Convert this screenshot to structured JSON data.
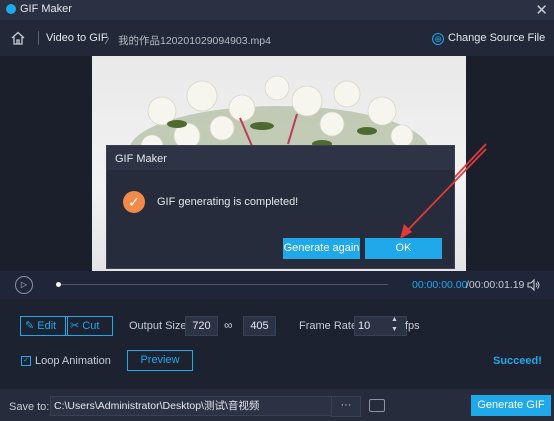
{
  "window": {
    "title": "GIF Maker",
    "close_glyph": "✕"
  },
  "nav": {
    "home_icon": "home-icon",
    "crumb_root": "Video to GIF",
    "crumb_chevron": "〉",
    "crumb_file": "我的作品120201029094903.mp4",
    "change_source_icon": "⊕",
    "change_source": "Change Source File"
  },
  "dialog": {
    "title": "GIF Maker",
    "check_glyph": "✓",
    "message": "GIF generating is completed!",
    "generate_again": "Generate again",
    "ok": "OK"
  },
  "playback": {
    "play_glyph": "▷",
    "time_current": "00:00:00.00",
    "time_total": "/00:00:01.19",
    "progress": 0
  },
  "controls": {
    "edit": "Edit",
    "cut": "Cut",
    "output_size_label": "Output Size:",
    "width": "720",
    "link_glyph": "∞",
    "height": "405",
    "frame_rate_label": "Frame Rate:",
    "frame_rate": "10",
    "fps": "fps",
    "loop_label": "Loop Animation",
    "loop_checked": true,
    "preview": "Preview",
    "status": "Succeed!"
  },
  "save": {
    "label": "Save to:",
    "path": "C:\\Users\\Administrator\\Desktop\\测试\\音视频",
    "browse": "···",
    "generate_gif": "Generate GIF"
  },
  "colors": {
    "accent": "#1fa8ea",
    "check": "#f08a4b",
    "arrow": "#e03a3a"
  }
}
